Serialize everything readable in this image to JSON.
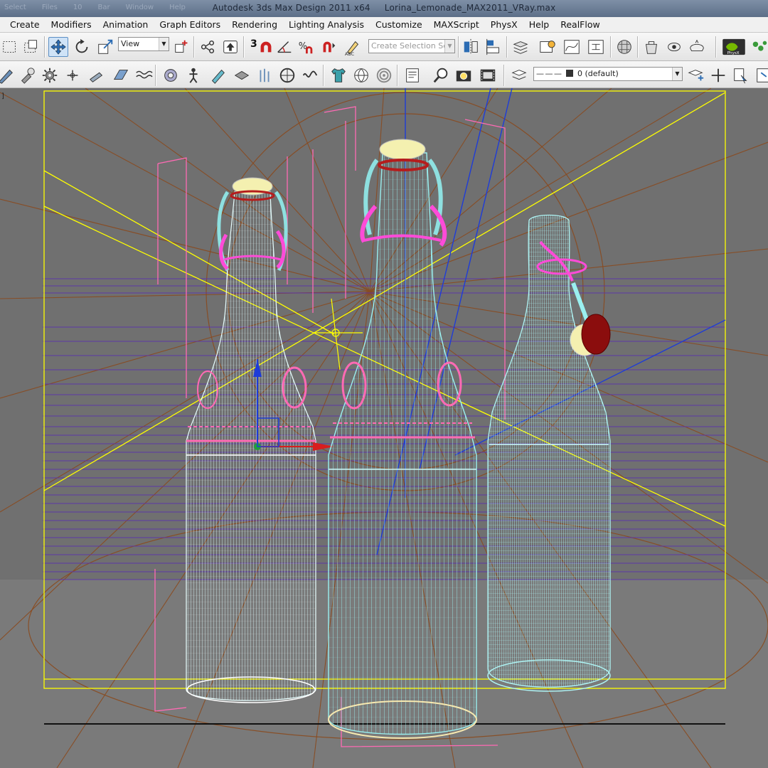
{
  "window": {
    "title": "Autodesk 3ds Max Design 2011 x64",
    "file": "Lorina_Lemonade_MAX2011_VRay.max",
    "ghost_menu": [
      "Select",
      "Files",
      "10",
      "Bar",
      "Window",
      "Help"
    ]
  },
  "menu": [
    {
      "label": "Create"
    },
    {
      "label": "Modifiers"
    },
    {
      "label": "Animation"
    },
    {
      "label": "Graph Editors"
    },
    {
      "label": "Rendering"
    },
    {
      "label": "Lighting Analysis"
    },
    {
      "label": "Customize"
    },
    {
      "label": "MAXScript"
    },
    {
      "label": "PhysX"
    },
    {
      "label": "Help"
    },
    {
      "label": "RealFlow"
    }
  ],
  "toolbar_main": {
    "reference_coord": "View",
    "snap_label": "3",
    "selection_set_placeholder": "Create Selection Se"
  },
  "toolbar_secondary": {
    "layer_value": "0 (default)"
  },
  "viewport": {
    "label": "]",
    "grid_color": "#8a4a1e",
    "wire_color": "#9af0f0",
    "helper_color": "#ff6ab4",
    "selection_color": "#ffff00"
  },
  "icons": {
    "select_region": "dashed-rect-icon",
    "move": "move-arrows-icon",
    "rotate": "rotate-icon",
    "scale": "scale-icon",
    "pivot": "pivot-icon",
    "nvidia": "physx-icon"
  }
}
